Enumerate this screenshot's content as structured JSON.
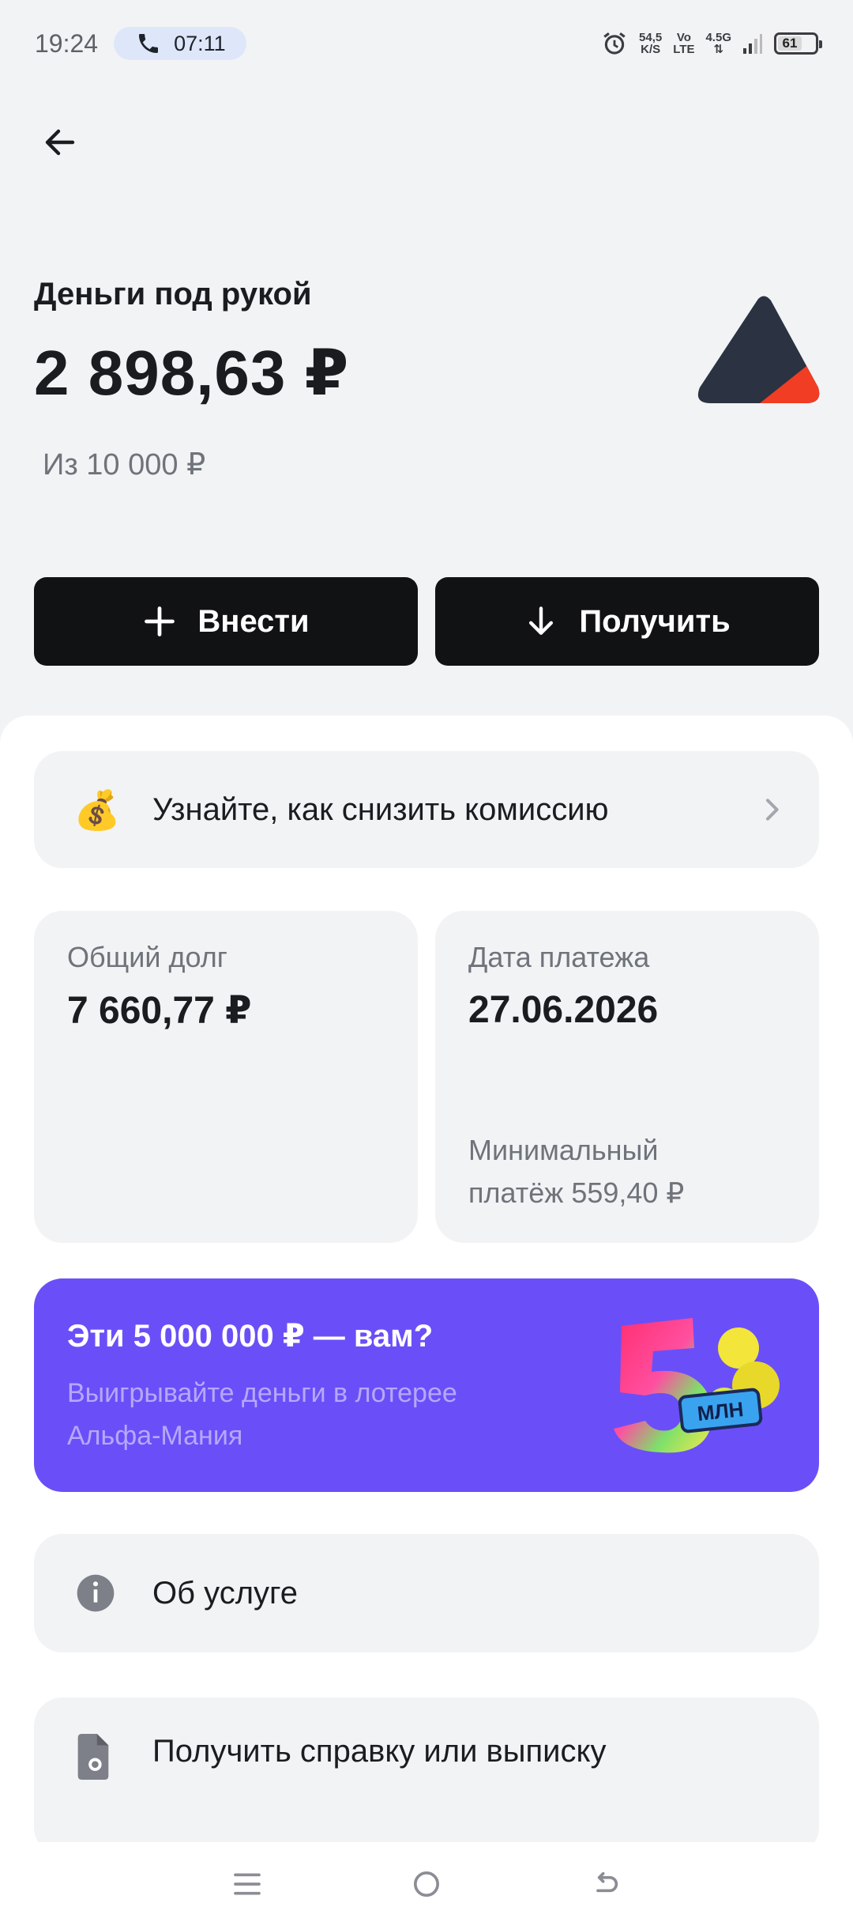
{
  "status_bar": {
    "time": "19:24",
    "call_duration": "07:11",
    "net_speed_value": "54,5",
    "net_speed_unit": "K/S",
    "volte_top": "Vo",
    "volte_bottom": "LTE",
    "network": "4.5G",
    "battery": "61"
  },
  "header": {
    "product_title": "Деньги под рукой",
    "balance": "2 898,63 ₽",
    "limit": "Из 10 000 ₽"
  },
  "actions": {
    "deposit_label": "Внести",
    "receive_label": "Получить"
  },
  "promo": {
    "emoji": "💰",
    "text": "Узнайте, как снизить комиссию"
  },
  "debt": {
    "label": "Общий долг",
    "value": "7 660,77 ₽"
  },
  "payment": {
    "label": "Дата платежа",
    "date": "27.06.2026",
    "min_line1": "Минимальный",
    "min_line2": "платёж 559,40 ₽"
  },
  "lottery": {
    "title": "Эти 5 000 000 ₽ — вам?",
    "subtitle_line1": "Выигрывайте деньги в лотерее",
    "subtitle_line2": "Альфа-Мания",
    "badge": "МЛН",
    "accent": "#6a4ff8"
  },
  "menu": {
    "about": "Об услуге",
    "certificate": "Получить справку или выписку"
  },
  "colors": {
    "button_bg": "#111214",
    "logo_dark": "#2b3242",
    "logo_red": "#f03d23"
  },
  "icons": [
    "back-arrow-icon",
    "plus-icon",
    "arrow-down-icon",
    "money-bag-icon",
    "chevron-right-icon",
    "info-icon",
    "document-icon",
    "menu-icon",
    "home-icon",
    "back-icon"
  ]
}
